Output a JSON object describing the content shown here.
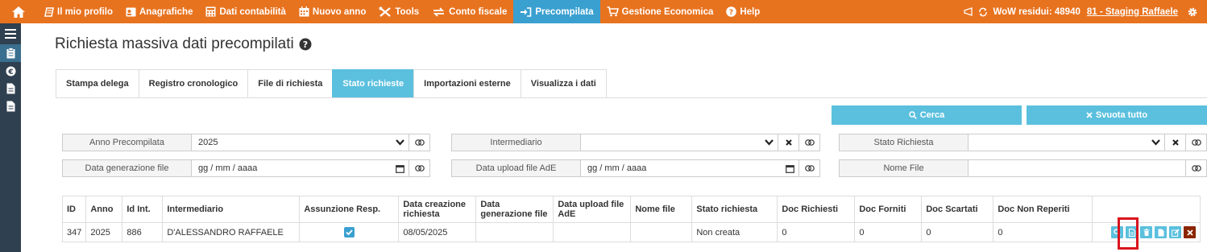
{
  "nav": {
    "items": [
      {
        "label": "Il mio profilo",
        "icon": "profile-icon"
      },
      {
        "label": "Anagrafiche",
        "icon": "contacts-icon"
      },
      {
        "label": "Dati contabilità",
        "icon": "calculator-icon"
      },
      {
        "label": "Nuovo anno",
        "icon": "calendar-icon"
      },
      {
        "label": "Tools",
        "icon": "tools-icon"
      },
      {
        "label": "Conto fiscale",
        "icon": "transfer-icon"
      },
      {
        "label": "Precompilata",
        "icon": "sign-in-icon",
        "active": true
      },
      {
        "label": "Gestione Economica",
        "icon": "cart-icon"
      },
      {
        "label": "Help",
        "icon": "help-icon"
      }
    ],
    "wow_label": "WoW residui: 48940",
    "user": "81 - Staging Raffaele"
  },
  "page": {
    "title": "Richiesta massiva dati precompilati"
  },
  "tabs": [
    {
      "label": "Stampa delega"
    },
    {
      "label": "Registro cronologico"
    },
    {
      "label": "File di richiesta"
    },
    {
      "label": "Stato richieste",
      "active": true
    },
    {
      "label": "Importazioni esterne"
    },
    {
      "label": "Visualizza i dati"
    }
  ],
  "buttons": {
    "search": "Cerca",
    "clear": "Svuota tutto"
  },
  "filters": {
    "anno_label": "Anno Precompilata",
    "anno_value": "2025",
    "intermediario_label": "Intermediario",
    "intermediario_value": "",
    "stato_label": "Stato Richiesta",
    "stato_value": "",
    "data_gen_label": "Data generazione file",
    "data_gen_placeholder": "gg / mm / aaaa",
    "data_upload_label": "Data upload file AdE",
    "data_upload_placeholder": "gg / mm / aaaa",
    "nome_file_label": "Nome File",
    "nome_file_value": ""
  },
  "table": {
    "headers": [
      "ID",
      "Anno",
      "Id Int.",
      "Intermediario",
      "Assunzione Resp.",
      "Data creazione richiesta",
      "Data generazione file",
      "Data upload file AdE",
      "Nome file",
      "Stato richiesta",
      "Doc Richiesti",
      "Doc Forniti",
      "Doc Scartati",
      "Doc Non Reperiti",
      ""
    ],
    "rows": [
      {
        "id": "347",
        "anno": "2025",
        "id_int": "886",
        "intermediario": "D'ALESSANDRO RAFFAELE",
        "assunzione": true,
        "data_creazione": "08/05/2025",
        "data_generazione": "",
        "data_upload": "",
        "nome_file": "",
        "stato": "Non creata",
        "doc_richiesti": "0",
        "doc_forniti": "0",
        "doc_scartati": "0",
        "doc_non_reperiti": "0"
      }
    ]
  },
  "colors": {
    "topbar": "#e8731f",
    "active_tab": "#5bc0de",
    "sidebar": "#2f4050",
    "highlight": "#d9141e"
  }
}
